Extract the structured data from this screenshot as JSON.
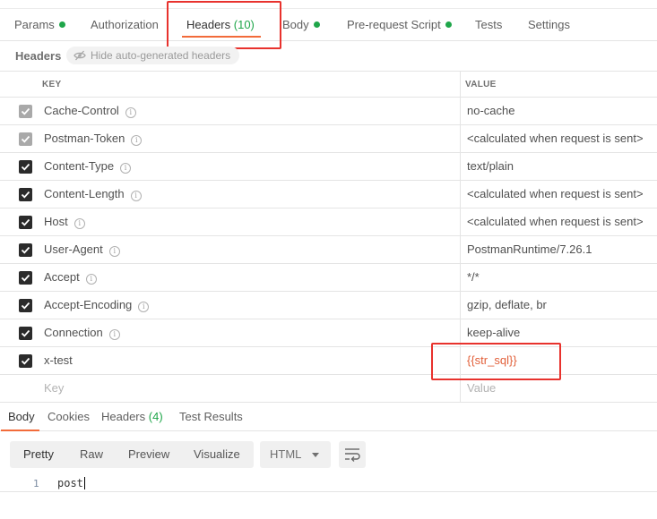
{
  "request_tabs": [
    {
      "label": "Params",
      "dot": true
    },
    {
      "label": "Authorization",
      "dot": false
    },
    {
      "label": "Headers",
      "count": "(10)",
      "active": true
    },
    {
      "label": "Body",
      "dot": true
    },
    {
      "label": "Pre-request Script",
      "dot": true
    },
    {
      "label": "Tests",
      "dot": false
    },
    {
      "label": "Settings",
      "dot": false
    }
  ],
  "headers_section": {
    "label": "Headers",
    "hide_auto_label": "Hide auto-generated headers"
  },
  "table": {
    "col_key": "KEY",
    "col_value": "VALUE",
    "rows": [
      {
        "key": "Cache-Control",
        "value": "no-cache",
        "checked": true,
        "muted": true
      },
      {
        "key": "Postman-Token",
        "value": "<calculated when request is sent>",
        "checked": true,
        "muted": true
      },
      {
        "key": "Content-Type",
        "value": "text/plain",
        "checked": true
      },
      {
        "key": "Content-Length",
        "value": "<calculated when request is sent>",
        "checked": true
      },
      {
        "key": "Host",
        "value": "<calculated when request is sent>",
        "checked": true
      },
      {
        "key": "User-Agent",
        "value": "PostmanRuntime/7.26.1",
        "checked": true
      },
      {
        "key": "Accept",
        "value": "*/*",
        "checked": true
      },
      {
        "key": "Accept-Encoding",
        "value": "gzip, deflate, br",
        "checked": true
      },
      {
        "key": "Connection",
        "value": "keep-alive",
        "checked": true
      },
      {
        "key": "x-test",
        "value": "{{str_sql}}",
        "checked": true
      }
    ],
    "new_key_placeholder": "Key",
    "new_value_placeholder": "Value"
  },
  "response_tabs": [
    {
      "label": "Body",
      "active": true
    },
    {
      "label": "Cookies"
    },
    {
      "label": "Headers",
      "count": "(4)"
    },
    {
      "label": "Test Results"
    }
  ],
  "view_modes": [
    "Pretty",
    "Raw",
    "Preview",
    "Visualize"
  ],
  "format_select": "HTML",
  "code": {
    "line_number": "1",
    "text": "post"
  },
  "colors": {
    "accent": "#f26b3a",
    "green": "#1fa64a",
    "highlight": "#e8322d",
    "variable": "#e2603a"
  }
}
